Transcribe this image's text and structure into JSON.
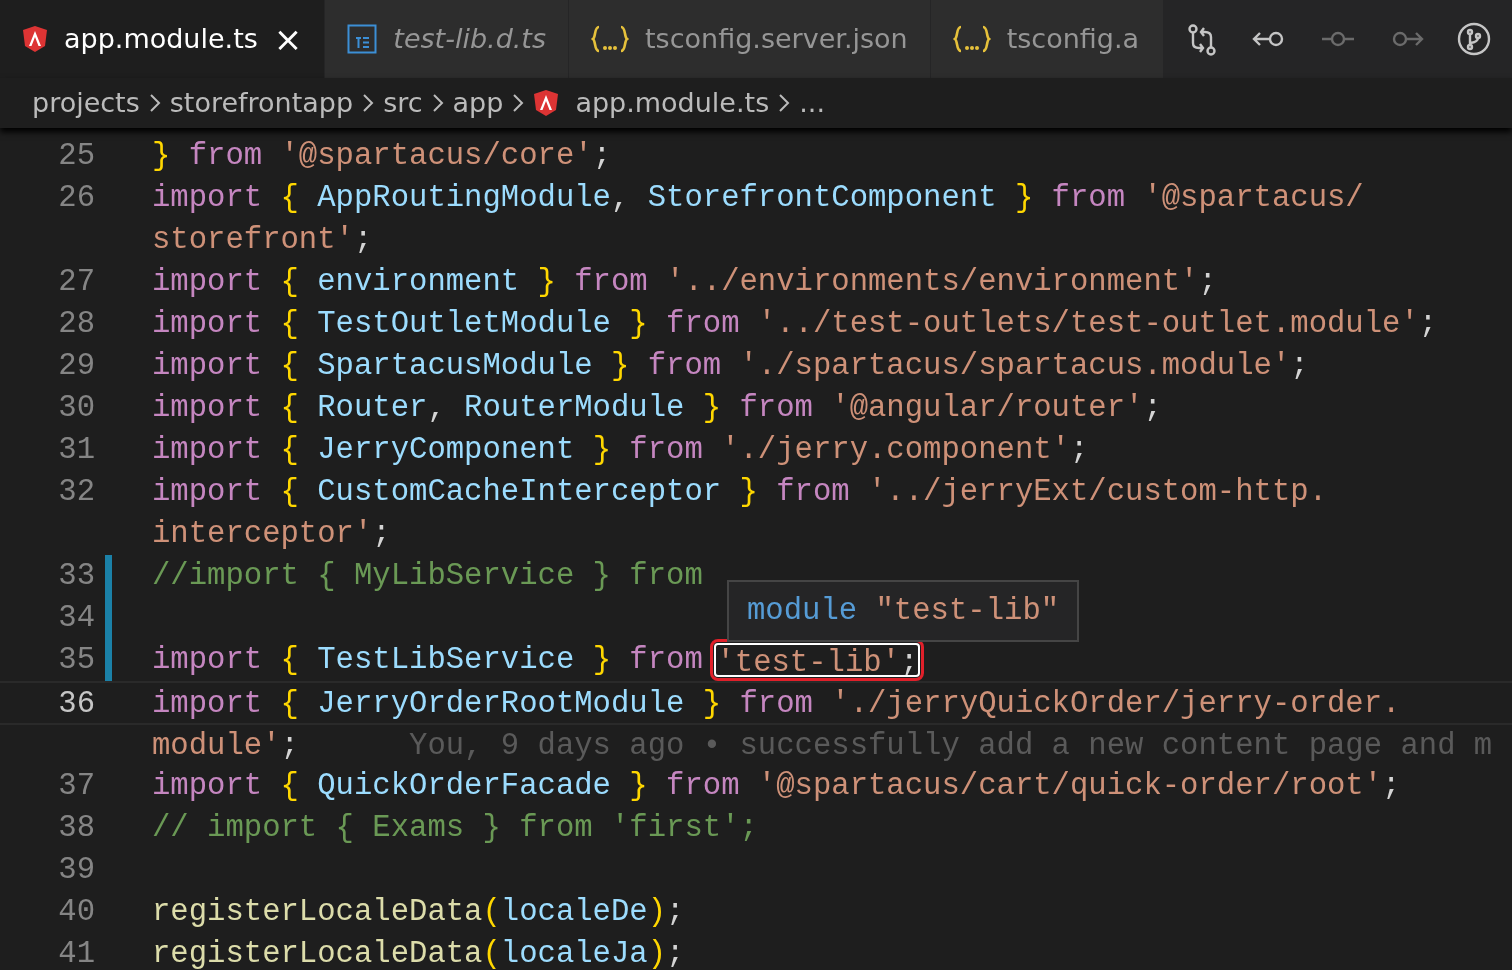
{
  "tabs": [
    {
      "label": "app.module.ts",
      "kind": "angular",
      "selected": true,
      "preview": false,
      "close": "×"
    },
    {
      "label": "test-lib.d.ts",
      "kind": "ts",
      "selected": false,
      "preview": true
    },
    {
      "label": "tsconfig.server.json",
      "kind": "json",
      "selected": false,
      "preview": false
    },
    {
      "label": "tsconfig.a",
      "kind": "json",
      "selected": false,
      "preview": false
    }
  ],
  "editor_actions": [
    {
      "kind": "compare",
      "disabled": false
    },
    {
      "kind": "back",
      "disabled": false
    },
    {
      "kind": "dot",
      "disabled": true
    },
    {
      "kind": "forward",
      "disabled": true
    },
    {
      "kind": "branch",
      "disabled": false
    }
  ],
  "breadcrumbs": [
    {
      "label": "projects"
    },
    {
      "label": "storefrontapp"
    },
    {
      "label": "src"
    },
    {
      "label": "app"
    },
    {
      "label": "app.module.ts",
      "kind": "angular"
    },
    {
      "label": "..."
    }
  ],
  "code_rows": [
    {
      "number": "25",
      "git_change": false,
      "current": false,
      "tokens": [
        {
          "text": "}",
          "kind": "brace"
        },
        {
          "text": "from",
          "kind": "keyword"
        },
        {
          "text": "'@spartacus/core'",
          "kind": "string"
        },
        {
          "text": ";",
          "kind": "punct",
          "attached": true
        }
      ]
    },
    {
      "number": "26",
      "git_change": false,
      "current": false,
      "tokens": [
        {
          "text": "import",
          "kind": "keyword"
        },
        {
          "text": "{",
          "kind": "brace"
        },
        {
          "text": "AppRoutingModule",
          "kind": "ident"
        },
        {
          "text": ",",
          "kind": "punct",
          "attached": true
        },
        {
          "text": "StorefrontComponent",
          "kind": "ident"
        },
        {
          "text": "}",
          "kind": "brace"
        },
        {
          "text": "from",
          "kind": "keyword"
        },
        {
          "text": "'@spartacus/",
          "kind": "string"
        }
      ]
    },
    {
      "git_change": false,
      "current": false,
      "tokens": [
        {
          "text": "storefront'",
          "kind": "string"
        },
        {
          "text": ";",
          "kind": "punct",
          "attached": true
        }
      ]
    },
    {
      "number": "27",
      "git_change": false,
      "current": false,
      "tokens": [
        {
          "text": "import",
          "kind": "keyword"
        },
        {
          "text": "{",
          "kind": "brace"
        },
        {
          "text": "environment",
          "kind": "ident"
        },
        {
          "text": "}",
          "kind": "brace"
        },
        {
          "text": "from",
          "kind": "keyword"
        },
        {
          "text": "'../environments/environment'",
          "kind": "string"
        },
        {
          "text": ";",
          "kind": "punct",
          "attached": true
        }
      ]
    },
    {
      "number": "28",
      "git_change": false,
      "current": false,
      "tokens": [
        {
          "text": "import",
          "kind": "keyword"
        },
        {
          "text": "{",
          "kind": "brace"
        },
        {
          "text": "TestOutletModule",
          "kind": "ident"
        },
        {
          "text": "}",
          "kind": "brace"
        },
        {
          "text": "from",
          "kind": "keyword"
        },
        {
          "text": "'../test-outlets/test-outlet.module'",
          "kind": "string"
        },
        {
          "text": ";",
          "kind": "punct",
          "attached": true
        }
      ]
    },
    {
      "number": "29",
      "git_change": false,
      "current": false,
      "tokens": [
        {
          "text": "import",
          "kind": "keyword"
        },
        {
          "text": "{",
          "kind": "brace"
        },
        {
          "text": "SpartacusModule",
          "kind": "ident"
        },
        {
          "text": "}",
          "kind": "brace"
        },
        {
          "text": "from",
          "kind": "keyword"
        },
        {
          "text": "'./spartacus/spartacus.module'",
          "kind": "string"
        },
        {
          "text": ";",
          "kind": "punct",
          "attached": true
        }
      ]
    },
    {
      "number": "30",
      "git_change": false,
      "current": false,
      "tokens": [
        {
          "text": "import",
          "kind": "keyword"
        },
        {
          "text": "{",
          "kind": "brace"
        },
        {
          "text": "Router",
          "kind": "ident"
        },
        {
          "text": ",",
          "kind": "punct",
          "attached": true
        },
        {
          "text": "RouterModule",
          "kind": "ident"
        },
        {
          "text": "}",
          "kind": "brace"
        },
        {
          "text": "from",
          "kind": "keyword"
        },
        {
          "text": "'@angular/router'",
          "kind": "string"
        },
        {
          "text": ";",
          "kind": "punct",
          "attached": true
        }
      ]
    },
    {
      "number": "31",
      "git_change": false,
      "current": false,
      "tokens": [
        {
          "text": "import",
          "kind": "keyword"
        },
        {
          "text": "{",
          "kind": "brace"
        },
        {
          "text": "JerryComponent",
          "kind": "ident"
        },
        {
          "text": "}",
          "kind": "brace"
        },
        {
          "text": "from",
          "kind": "keyword"
        },
        {
          "text": "'./jerry.component'",
          "kind": "string"
        },
        {
          "text": ";",
          "kind": "punct",
          "attached": true
        }
      ]
    },
    {
      "number": "32",
      "git_change": false,
      "current": false,
      "tokens": [
        {
          "text": "import",
          "kind": "keyword"
        },
        {
          "text": "{",
          "kind": "brace"
        },
        {
          "text": "CustomCacheInterceptor",
          "kind": "ident"
        },
        {
          "text": "}",
          "kind": "brace"
        },
        {
          "text": "from",
          "kind": "keyword"
        },
        {
          "text": "'../jerryExt/custom-http.",
          "kind": "string"
        }
      ]
    },
    {
      "git_change": false,
      "current": false,
      "tokens": [
        {
          "text": "interceptor'",
          "kind": "string"
        },
        {
          "text": ";",
          "kind": "punct",
          "attached": true
        }
      ]
    },
    {
      "number": "33",
      "git_change": true,
      "current": false,
      "tokens": [
        {
          "text": "//import { MyLibService } from",
          "kind": "comment"
        }
      ]
    },
    {
      "number": "34",
      "git_change": true,
      "current": false,
      "tokens": []
    },
    {
      "number": "35",
      "git_change": true,
      "current": false,
      "tokens": [
        {
          "text": "import",
          "kind": "keyword"
        },
        {
          "text": "{",
          "kind": "brace"
        },
        {
          "text": "TestLibService",
          "kind": "ident"
        },
        {
          "text": "}",
          "kind": "brace"
        },
        {
          "text": "from",
          "kind": "keyword"
        },
        {
          "text": "'test-lib'",
          "kind": "string",
          "boxed": true
        },
        {
          "text": ";",
          "kind": "punct",
          "attached": true,
          "boxed": true
        }
      ]
    },
    {
      "number": "36",
      "git_change": false,
      "current": true,
      "tokens": [
        {
          "text": "import",
          "kind": "keyword"
        },
        {
          "text": "{",
          "kind": "brace"
        },
        {
          "text": "JerryOrderRootModule",
          "kind": "ident"
        },
        {
          "text": "}",
          "kind": "brace"
        },
        {
          "text": "from",
          "kind": "keyword"
        },
        {
          "text": "'./jerryQuickOrder/jerry-order.",
          "kind": "string"
        }
      ]
    },
    {
      "git_change": false,
      "current": true,
      "tokens": [
        {
          "text": "module'",
          "kind": "string"
        },
        {
          "text": ";",
          "kind": "punct",
          "attached": true
        },
        {
          "text": "You, 9 days ago • successfully add a new content page and m",
          "kind": "blame"
        }
      ]
    },
    {
      "number": "37",
      "git_change": false,
      "current": false,
      "tokens": [
        {
          "text": "import",
          "kind": "keyword"
        },
        {
          "text": "{",
          "kind": "brace"
        },
        {
          "text": "QuickOrderFacade",
          "kind": "ident"
        },
        {
          "text": "}",
          "kind": "brace"
        },
        {
          "text": "from",
          "kind": "keyword"
        },
        {
          "text": "'@spartacus/cart/quick-order/root'",
          "kind": "string"
        },
        {
          "text": ";",
          "kind": "punct",
          "attached": true
        }
      ]
    },
    {
      "number": "38",
      "git_change": false,
      "current": false,
      "tokens": [
        {
          "text": "// import { Exams } from 'first';",
          "kind": "comment"
        }
      ]
    },
    {
      "number": "39",
      "git_change": false,
      "current": false,
      "tokens": []
    },
    {
      "number": "40",
      "git_change": false,
      "current": false,
      "tokens": [
        {
          "text": "registerLocaleData",
          "kind": "func"
        },
        {
          "text": "(",
          "kind": "brace",
          "attached": true
        },
        {
          "text": "localeDe",
          "kind": "ident",
          "attached": true
        },
        {
          "text": ")",
          "kind": "brace",
          "attached": true
        },
        {
          "text": ";",
          "kind": "punct",
          "attached": true
        }
      ]
    },
    {
      "number": "41",
      "git_change": false,
      "current": false,
      "tokens": [
        {
          "text": "registerLocaleData",
          "kind": "func"
        },
        {
          "text": "(",
          "kind": "brace",
          "attached": true
        },
        {
          "text": "localeJa",
          "kind": "ident",
          "attached": true
        },
        {
          "text": ")",
          "kind": "brace",
          "attached": true
        },
        {
          "text": ";",
          "kind": "punct",
          "attached": true
        }
      ]
    }
  ],
  "hover": {
    "keyword": "module",
    "name": "\"test-lib\""
  }
}
